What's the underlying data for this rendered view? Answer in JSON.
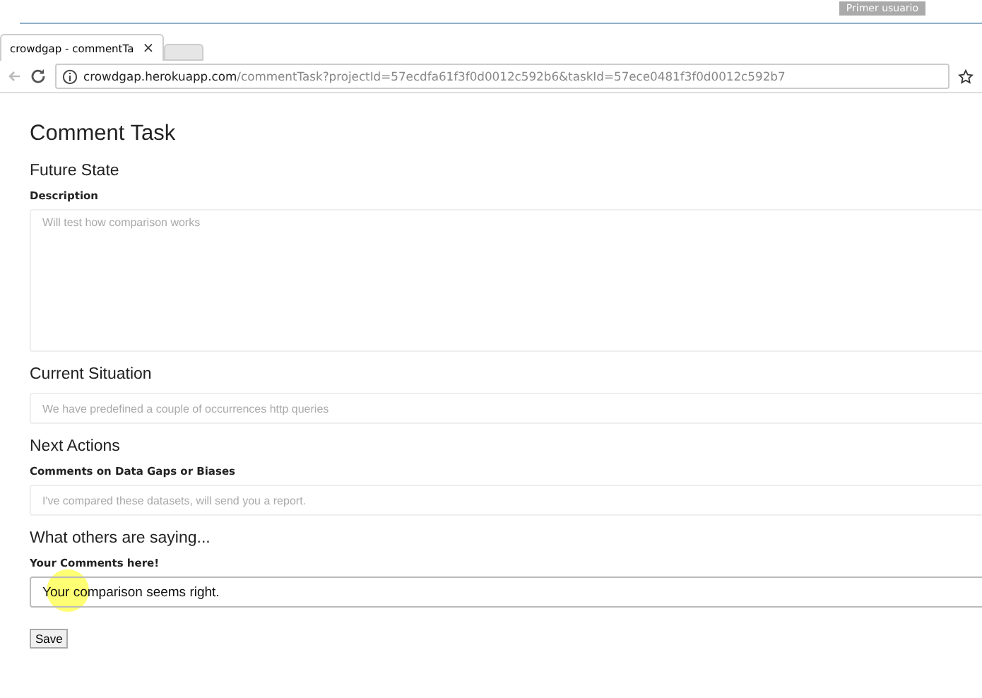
{
  "browser": {
    "profile": "Primer usuario",
    "tabs": [
      {
        "title": "crowdgap - commentTa",
        "close": "×",
        "selected": true
      },
      {
        "selected": false
      }
    ],
    "url_host": "crowdgap.herokuapp.com",
    "url_path": "/commentTask?projectId=57ecdfa61f3f0d0012c592b6&taskId=57ece0481f3f0d0012c592b7"
  },
  "page": {
    "title": "Comment Task",
    "sections": [
      {
        "heading": "Future State",
        "label": "Description",
        "kind": "textarea",
        "placeholder": "Will test how comparison works"
      },
      {
        "heading": "Current Situation",
        "kind": "input",
        "placeholder": "We have predefined a couple of occurrences http queries"
      },
      {
        "heading": "Next Actions",
        "label": "Comments on Data Gaps or Biases",
        "kind": "input",
        "placeholder": "I've compared these datasets, will send you a report."
      },
      {
        "heading": "What others are saying...",
        "label": "Your Comments here!",
        "kind": "active",
        "value": "Your comparison seems right."
      }
    ],
    "button": "Save"
  }
}
